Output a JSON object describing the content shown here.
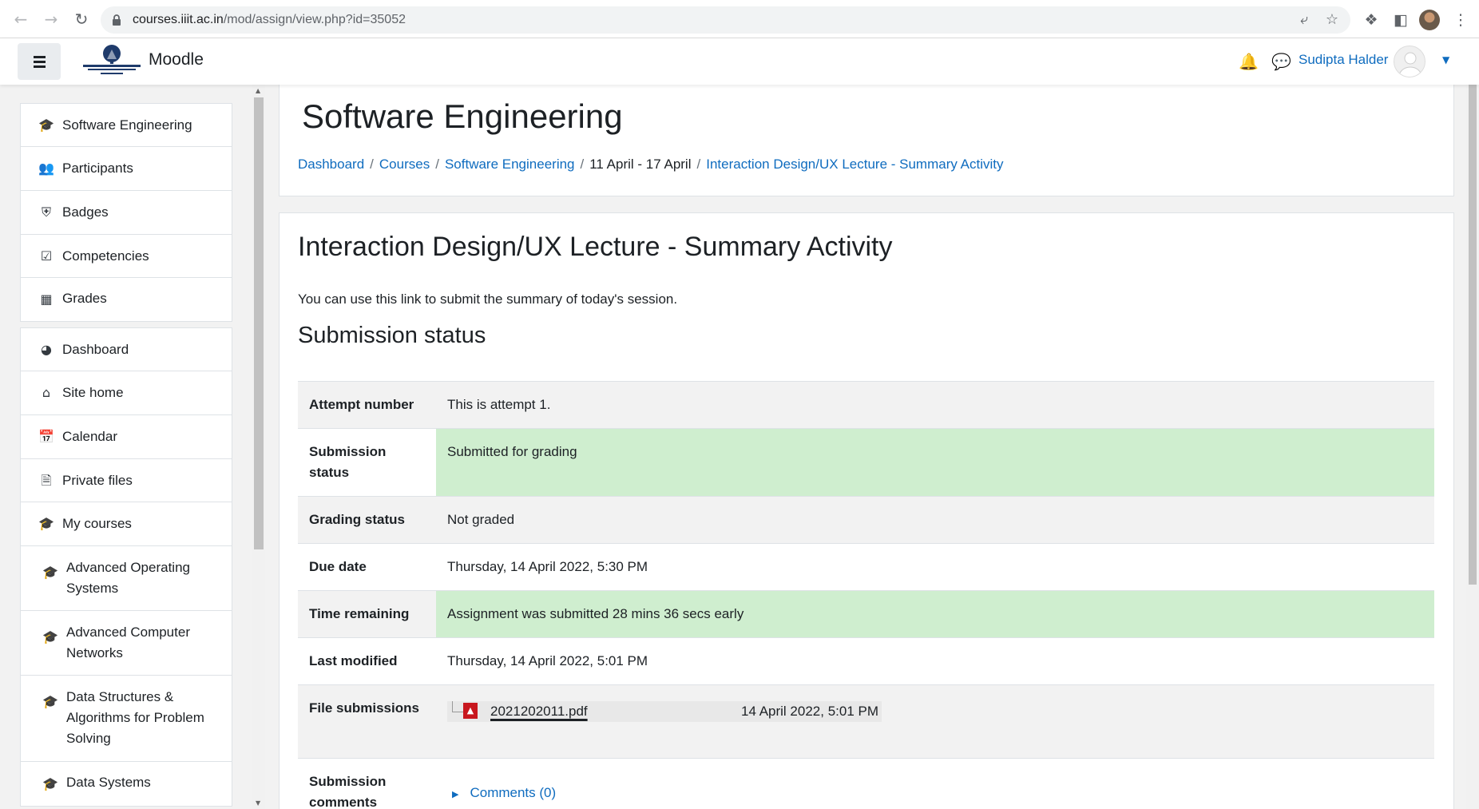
{
  "browser": {
    "url_host": "courses.iiit.ac.in",
    "url_path": "/mod/assign/view.php?id=35052"
  },
  "navbar": {
    "brand": "Moodle",
    "user_name": "Sudipta Halder"
  },
  "course_nav": [
    {
      "label": "Software Engineering",
      "icon": "graduation-cap-icon"
    },
    {
      "label": "Participants",
      "icon": "users-icon"
    },
    {
      "label": "Badges",
      "icon": "shield-icon"
    },
    {
      "label": "Competencies",
      "icon": "checkbox-icon"
    },
    {
      "label": "Grades",
      "icon": "table-icon"
    }
  ],
  "site_nav": [
    {
      "label": "Dashboard",
      "icon": "dashboard-icon"
    },
    {
      "label": "Site home",
      "icon": "home-icon"
    },
    {
      "label": "Calendar",
      "icon": "calendar-icon"
    },
    {
      "label": "Private files",
      "icon": "file-icon"
    },
    {
      "label": "My courses",
      "icon": "graduation-cap-icon"
    },
    {
      "label": "Advanced Operating Systems",
      "icon": "graduation-cap-icon"
    },
    {
      "label": "Advanced Computer Networks",
      "icon": "graduation-cap-icon"
    },
    {
      "label": "Data Structures & Algorithms for Problem Solving",
      "icon": "graduation-cap-icon"
    },
    {
      "label": "Data Systems",
      "icon": "graduation-cap-icon"
    }
  ],
  "header": {
    "course_title": "Software Engineering",
    "breadcrumb": [
      "Dashboard",
      "Courses",
      "Software Engineering",
      "11 April - 17 April",
      "Interaction Design/UX Lecture - Summary Activity"
    ]
  },
  "activity": {
    "title": "Interaction Design/UX Lecture - Summary Activity",
    "intro": "You can use this link to submit the summary of today's session.",
    "section_title": "Submission status"
  },
  "status": {
    "attempt_label": "Attempt number",
    "attempt_value": "This is attempt 1.",
    "submission_label": "Submission status",
    "submission_value": "Submitted for grading",
    "grading_label": "Grading status",
    "grading_value": "Not graded",
    "due_label": "Due date",
    "due_value": "Thursday, 14 April 2022, 5:30 PM",
    "remaining_label": "Time remaining",
    "remaining_value": "Assignment was submitted 28 mins 36 secs early",
    "modified_label": "Last modified",
    "modified_value": "Thursday, 14 April 2022, 5:01 PM",
    "files_label": "File submissions",
    "file_name": "2021202011.pdf",
    "file_date": "14 April 2022, 5:01 PM",
    "comments_label": "Submission comments",
    "comments_link": "Comments (0)",
    "highlight_color": "#cfeecf"
  },
  "colors": {
    "link": "#0f6cbf",
    "pdf": "#c8171e"
  }
}
